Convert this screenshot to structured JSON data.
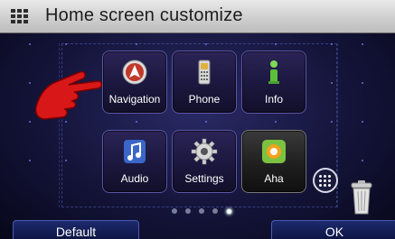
{
  "header": {
    "title": "Home screen customize",
    "icon": "menu-grid-icon"
  },
  "tiles": [
    {
      "label": "Navigation",
      "icon": "navigation-icon"
    },
    {
      "label": "Phone",
      "icon": "phone-icon"
    },
    {
      "label": "Info",
      "icon": "info-icon"
    },
    {
      "label": "Audio",
      "icon": "audio-icon"
    },
    {
      "label": "Settings",
      "icon": "settings-gear-icon"
    },
    {
      "label": "Aha",
      "icon": "aha-icon"
    }
  ],
  "pager": {
    "pages": 5,
    "active_page": 5
  },
  "controls": {
    "more_apps_icon": "more-apps-icon",
    "trash_icon": "trash-icon"
  },
  "footer": {
    "default_label": "Default",
    "ok_label": "OK"
  },
  "colors": {
    "accent": "#e01818",
    "tile_border": "#5b55a8",
    "background": "#14143a"
  },
  "overlay": {
    "icon": "pointing-hand-icon"
  }
}
